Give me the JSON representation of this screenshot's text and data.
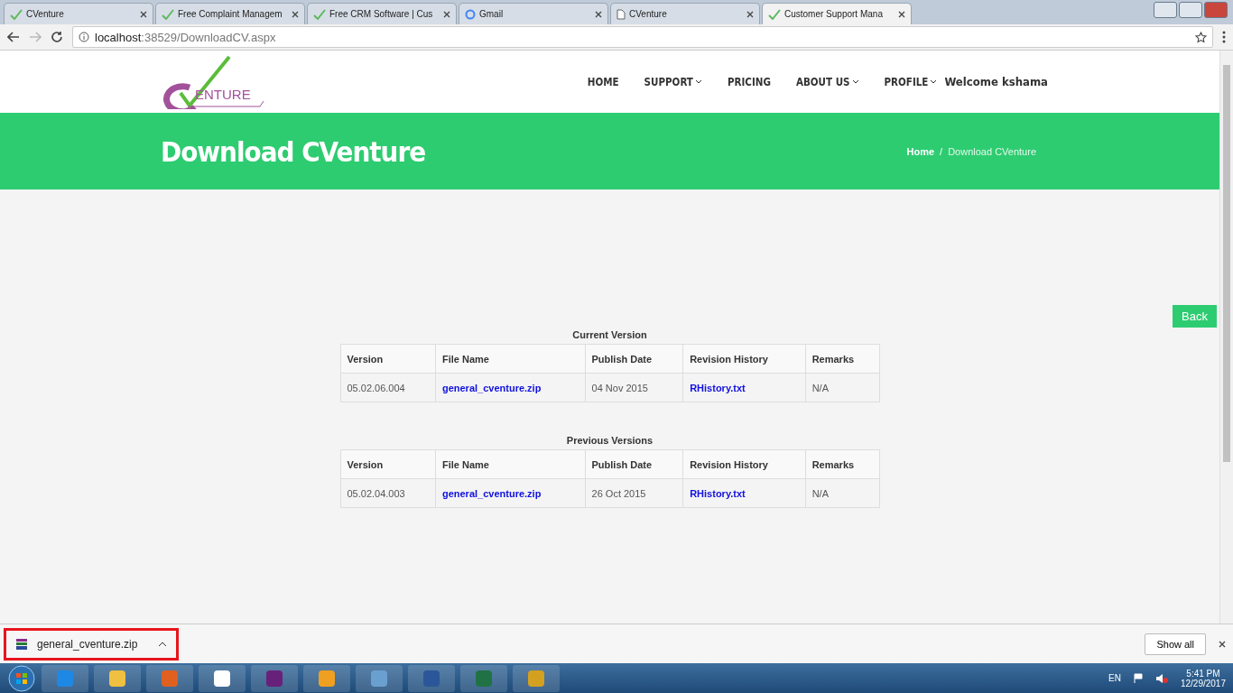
{
  "browser": {
    "tabs": [
      {
        "title": "CVenture",
        "kind": "check",
        "selected": false
      },
      {
        "title": "Free Complaint Managem",
        "kind": "check",
        "selected": false
      },
      {
        "title": "Free CRM Software | Cus",
        "kind": "check",
        "selected": false
      },
      {
        "title": "Gmail",
        "kind": "google",
        "selected": false
      },
      {
        "title": "CVenture",
        "kind": "doc",
        "selected": false
      },
      {
        "title": "Customer Support Mana",
        "kind": "check",
        "selected": true
      }
    ],
    "url_host": "localhost",
    "url_rest": ":38529/DownloadCV.aspx"
  },
  "header": {
    "logo_text": "ENTURE",
    "nav": [
      {
        "label": "HOME",
        "dropdown": false
      },
      {
        "label": "SUPPORT",
        "dropdown": true
      },
      {
        "label": "PRICING",
        "dropdown": false
      },
      {
        "label": "ABOUT US",
        "dropdown": true
      },
      {
        "label": "PROFILE",
        "dropdown": true
      }
    ],
    "welcome": "Welcome kshama"
  },
  "banner": {
    "title": "Download CVenture",
    "breadcrumb": [
      "Home",
      "Download CVenture"
    ],
    "separator": "/"
  },
  "back_button": "Back",
  "tables": [
    {
      "caption": "Current Version",
      "columns": [
        "Version",
        "File Name",
        "Publish Date",
        "Revision History",
        "Remarks"
      ],
      "rows": [
        [
          "05.02.06.004",
          "general_cventure.zip",
          "04 Nov 2015",
          "RHistory.txt",
          "N/A"
        ]
      ]
    },
    {
      "caption": "Previous Versions",
      "columns": [
        "Version",
        "File Name",
        "Publish Date",
        "Revision History",
        "Remarks"
      ],
      "rows": [
        [
          "05.02.04.003",
          "general_cventure.zip",
          "26 Oct 2015",
          "RHistory.txt",
          "N/A"
        ]
      ]
    }
  ],
  "download_bar": {
    "item": "general_cventure.zip",
    "highlighted": true,
    "show_all": "Show all"
  },
  "taskbar": {
    "language": "EN",
    "time": "5:41 PM",
    "date": "12/29/2017"
  }
}
